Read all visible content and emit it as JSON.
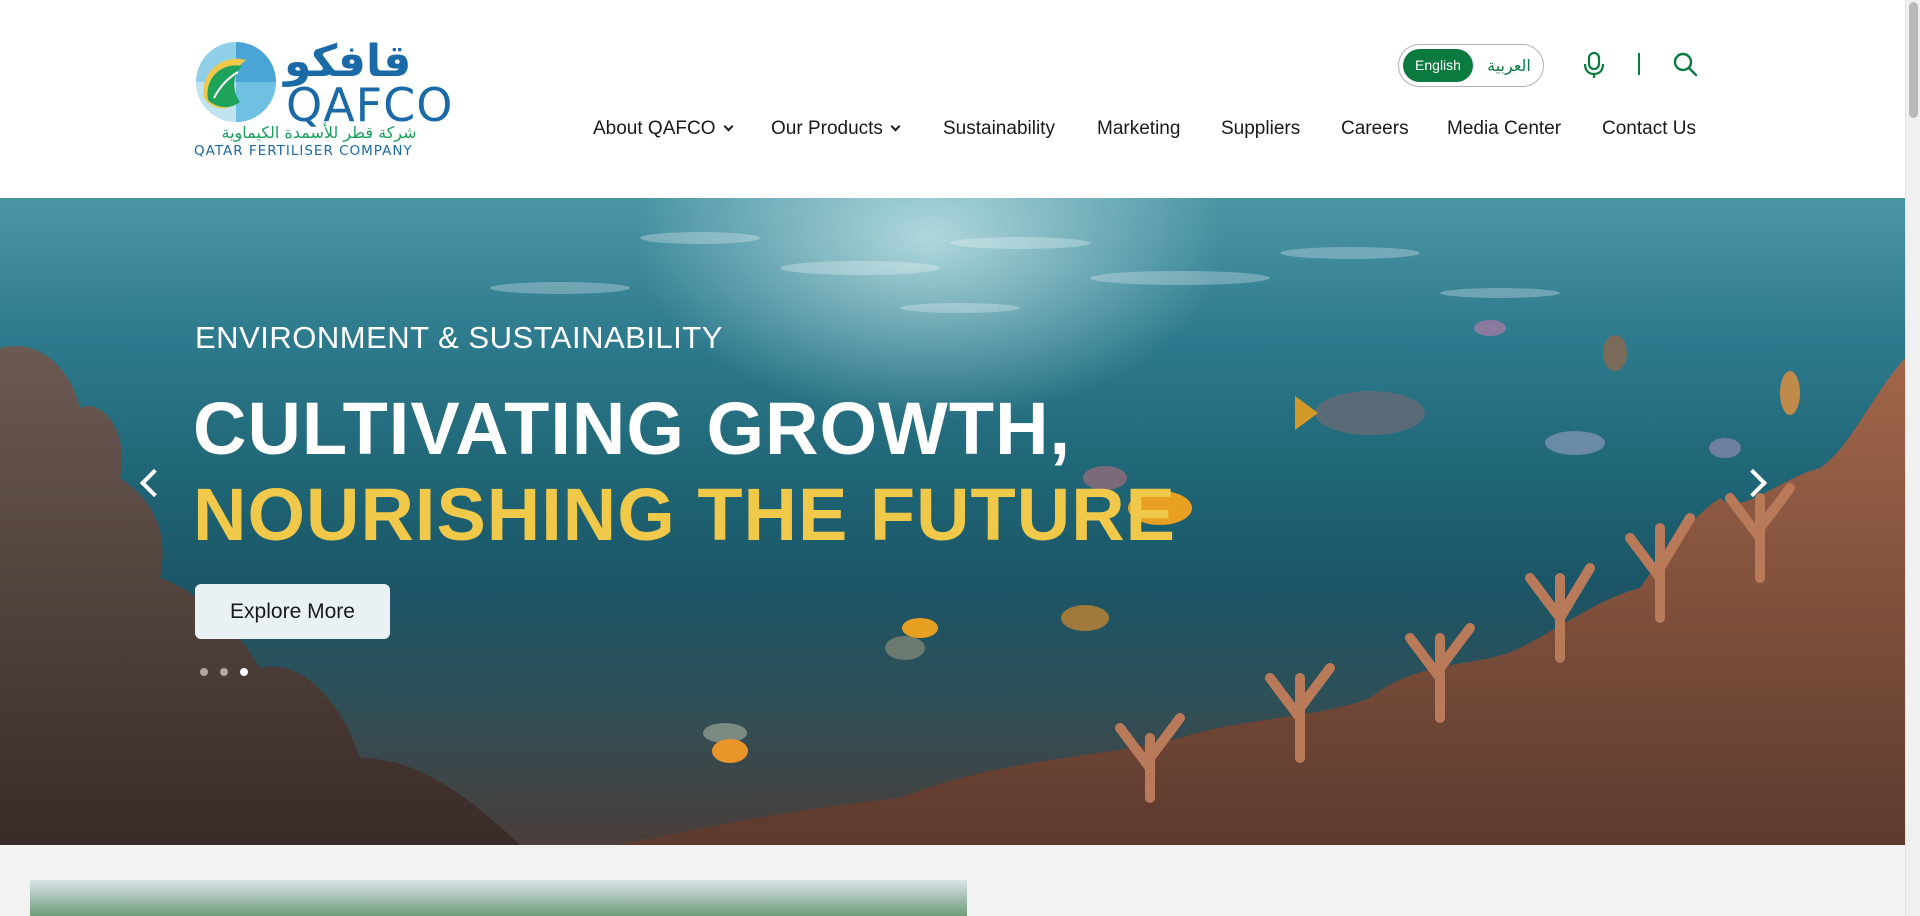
{
  "brand": {
    "arabic_name": "قافكو",
    "latin_name": "QAFCO",
    "arabic_tagline": "شركة قطر للأسمدة الكيماوية",
    "company_name": "QATAR FERTILISER COMPANY"
  },
  "language": {
    "english_label": "English",
    "arabic_label": "العربية",
    "active": "English"
  },
  "icons": {
    "voice_search": "mic-icon",
    "search": "search-icon"
  },
  "nav": {
    "items": [
      {
        "label": "About QAFCO",
        "has_dropdown": true
      },
      {
        "label": "Our Products",
        "has_dropdown": true
      },
      {
        "label": "Sustainability",
        "has_dropdown": false
      },
      {
        "label": "Marketing",
        "has_dropdown": false
      },
      {
        "label": "Suppliers",
        "has_dropdown": false
      },
      {
        "label": "Careers",
        "has_dropdown": false
      },
      {
        "label": "Media Center",
        "has_dropdown": false
      },
      {
        "label": "Contact Us",
        "has_dropdown": false
      }
    ]
  },
  "hero": {
    "eyebrow": "ENVIRONMENT & SUSTAINABILITY",
    "title_line_1": "CULTIVATING GROWTH,",
    "title_line_2": "NOURISHING THE FUTURE",
    "cta_label": "Explore More",
    "slide_count": 3,
    "active_slide": 3
  },
  "colors": {
    "brand_green": "#0a7a3f",
    "brand_blue": "#1b6aa8",
    "accent_yellow": "#f0c84a"
  }
}
